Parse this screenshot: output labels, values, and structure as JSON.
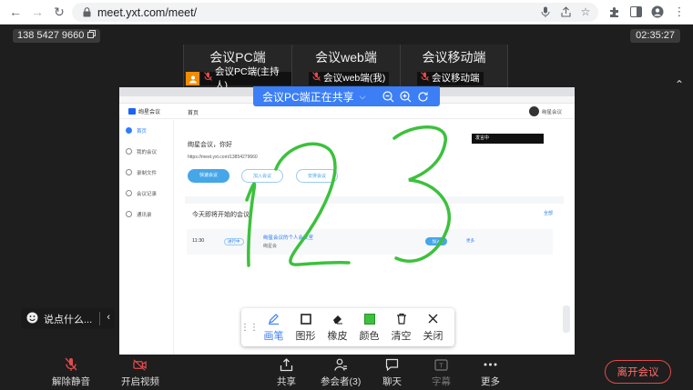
{
  "browser": {
    "url": "meet.yxt.com/meet/"
  },
  "meeting": {
    "phone": "138 5427 9660",
    "timer": "02:35:27"
  },
  "tiles": [
    {
      "title": "会议PC端",
      "tag": "会议PC端(主持人)",
      "host": true
    },
    {
      "title": "会议web端",
      "tag": "会议web端(我)",
      "host": false
    },
    {
      "title": "会议移动端",
      "tag": "会议移动端",
      "host": false
    }
  ],
  "share_banner": {
    "label": "会议PC端正在共享"
  },
  "shared_screen": {
    "brand": "绚星会议",
    "crumb": "首页",
    "user_menu": "绚星会议",
    "sidebar": [
      "首页",
      "我的会议",
      "录制文件",
      "会议记录",
      "通讯录"
    ],
    "greeting": "绚星会议，你好",
    "meeting_link": "https://meet.yxt.com/13854279660",
    "buttons": [
      "快速会议",
      "加入会议",
      "安排会议"
    ],
    "today_heading": "今天即将开始的会议",
    "all_link": "全部",
    "row": {
      "time": "11:30",
      "status": "进行中",
      "title": "绚星会议的个人会议室",
      "host": "绚星会",
      "join": "加入",
      "more": "更多"
    },
    "tooltip": "发言中",
    "handwriting": "123",
    "ink_color": "#3cc13c"
  },
  "annotation_toolbar": {
    "tools": [
      {
        "label": "画笔",
        "icon": "pen-icon",
        "active": true
      },
      {
        "label": "图形",
        "icon": "square-icon",
        "active": false
      },
      {
        "label": "橡皮",
        "icon": "eraser-icon",
        "active": false
      },
      {
        "label": "颜色",
        "icon": "color-swatch-icon",
        "active": false
      },
      {
        "label": "清空",
        "icon": "trash-icon",
        "active": false
      },
      {
        "label": "关闭",
        "icon": "close-icon",
        "active": false
      }
    ],
    "swatch_color": "#3cc13c"
  },
  "chat": {
    "placeholder": "说点什么..."
  },
  "bottom_bar": {
    "unmute": "解除静音",
    "video": "开启视频",
    "share": "共享",
    "participants": "参会者(3)",
    "chat": "聊天",
    "subtitles": "字幕",
    "more": "更多",
    "leave": "离开会议"
  },
  "colors": {
    "accent": "#3b7ef6",
    "danger": "#e24b4b",
    "host_badge": "#f08c00"
  }
}
